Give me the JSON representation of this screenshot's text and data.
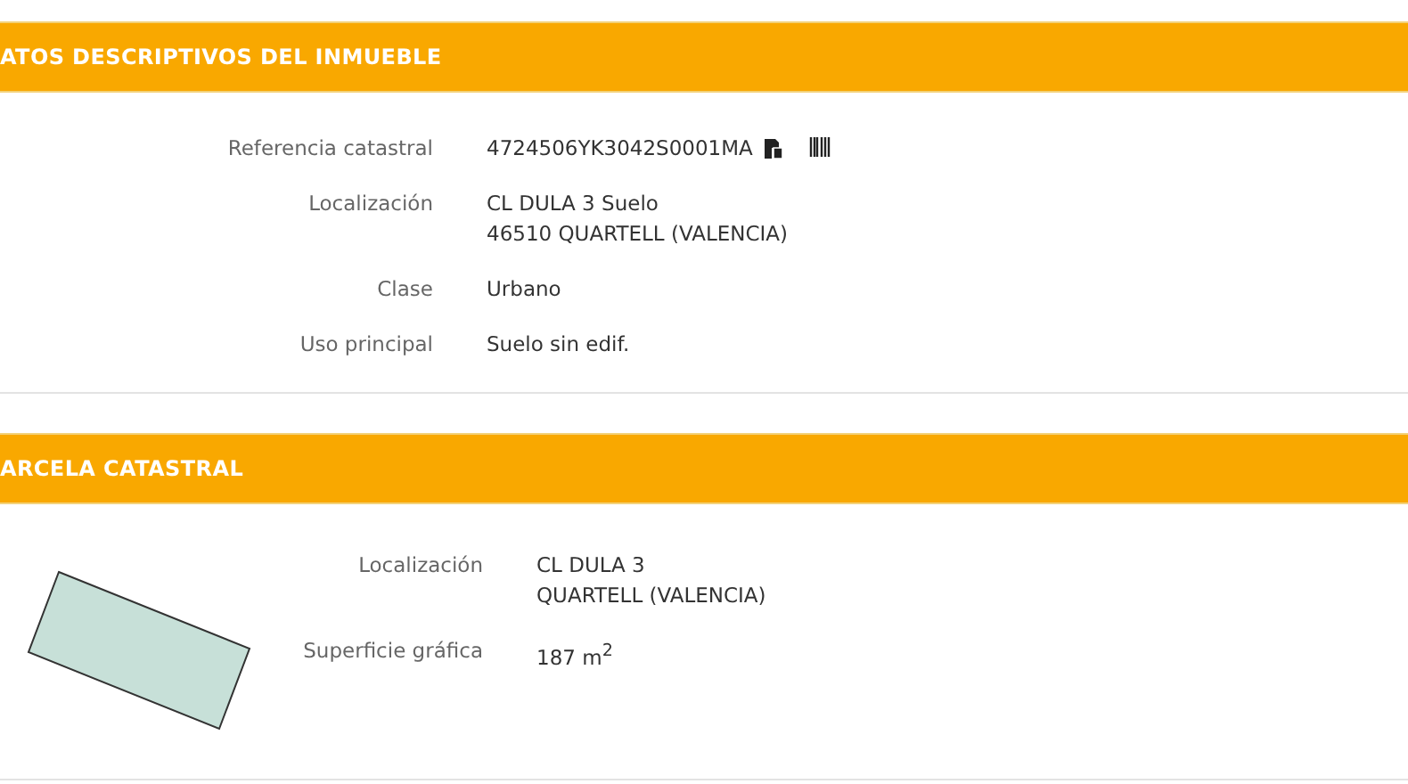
{
  "sections": [
    {
      "title": "ATOS DESCRIPTIVOS DEL INMUEBLE",
      "kind": "fields",
      "rows": [
        {
          "label": "Referencia catastral",
          "lines": [
            "4724506YK3042S0001MA"
          ],
          "icons": true
        },
        {
          "label": "Localización",
          "lines": [
            "CL DULA 3 Suelo",
            "46510 QUARTELL (VALENCIA)"
          ],
          "icons": false
        },
        {
          "label": "Clase",
          "lines": [
            "Urbano"
          ],
          "icons": false
        },
        {
          "label": "Uso principal",
          "lines": [
            "Suelo sin edif."
          ],
          "icons": false
        }
      ]
    },
    {
      "title": "ARCELA CATASTRAL",
      "kind": "parcel",
      "rows": [
        {
          "label": "Localización",
          "lines": [
            "CL DULA 3",
            "QUARTELL (VALENCIA)"
          ],
          "icons": false
        },
        {
          "label": "Superficie gráfica",
          "lines": [
            "187 m$^{2}$"
          ],
          "icons": false
        }
      ]
    }
  ]
}
